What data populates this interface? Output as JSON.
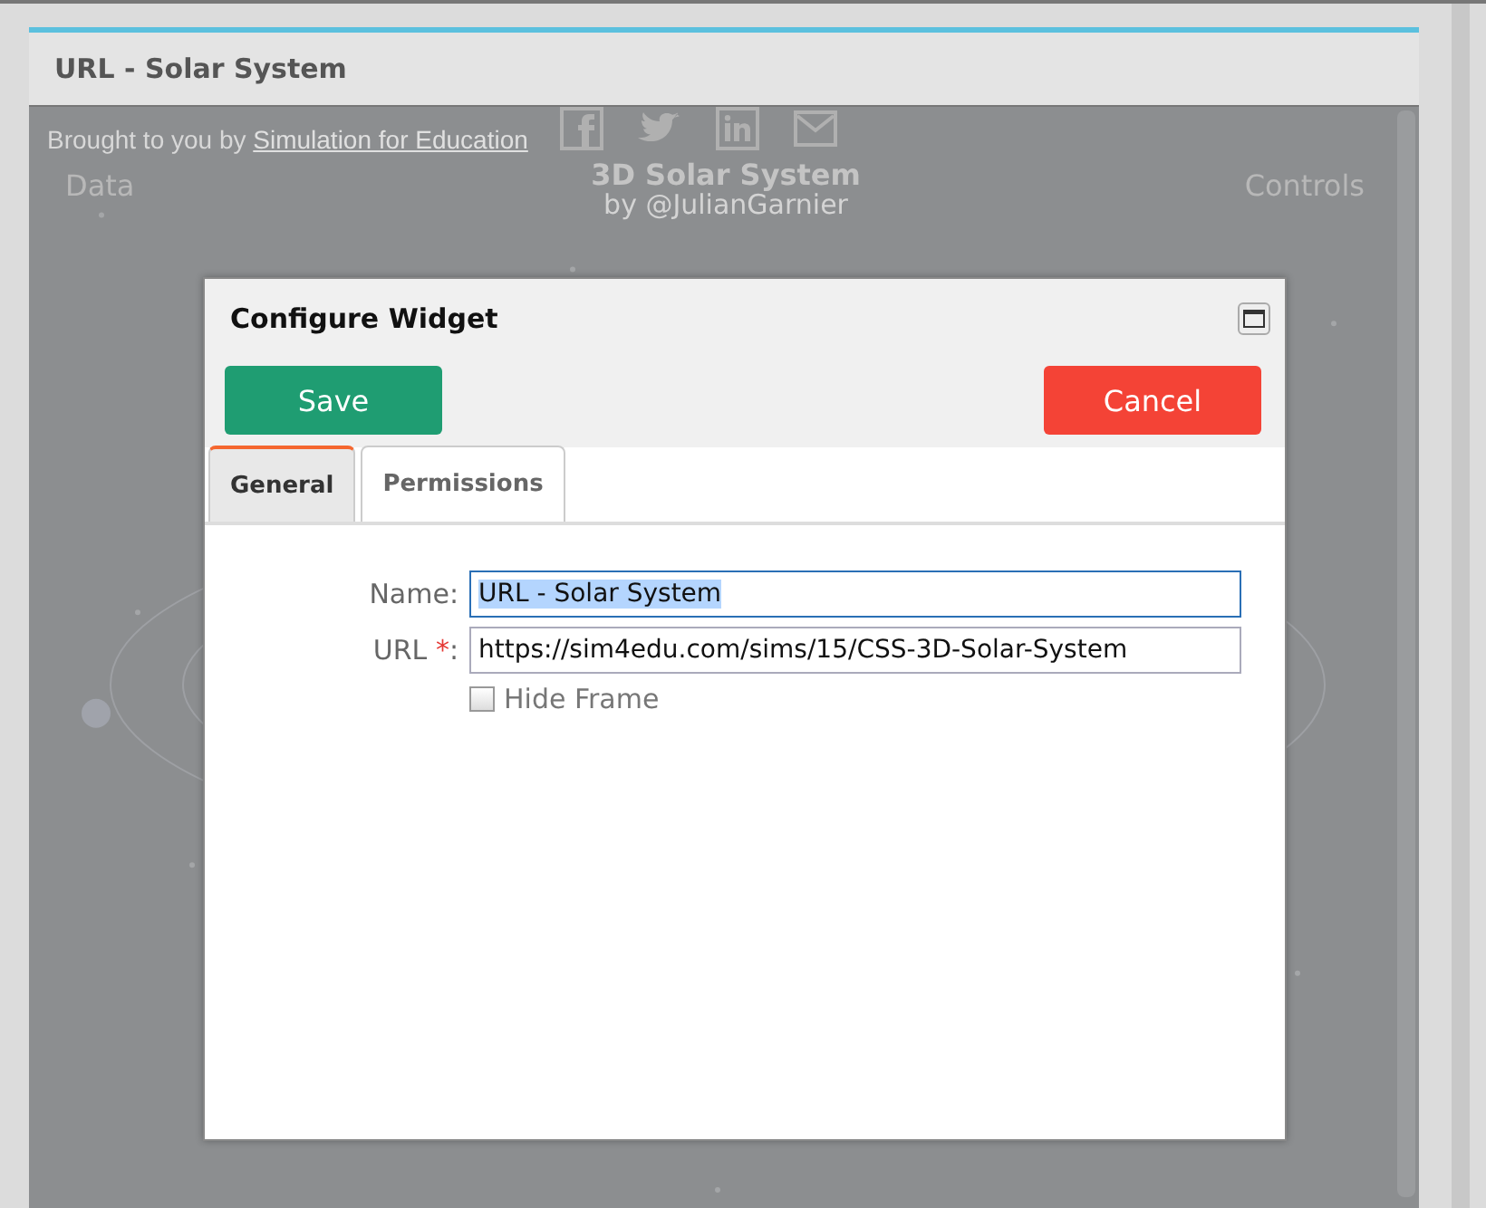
{
  "panel": {
    "title": "URL - Solar System"
  },
  "embed": {
    "credit": "Brought to you by",
    "credit_link": "Simulation for Education",
    "left_link": "Data",
    "title": "3D Solar System",
    "subtitle": "by @JulianGarnier",
    "right_link": "Controls",
    "share": [
      {
        "kind": "facebook"
      },
      {
        "kind": "twitter"
      },
      {
        "kind": "linkedin"
      },
      {
        "kind": "mail"
      }
    ]
  },
  "dialog": {
    "title": "Configure Widget",
    "buttons": [
      {
        "label": "Save",
        "kind": "primary"
      },
      {
        "label": "Cancel",
        "kind": "danger"
      }
    ],
    "tabs": [
      {
        "label": "General",
        "selected": true
      },
      {
        "label": "Permissions",
        "selected": false
      }
    ],
    "fields": [
      {
        "label": "Name:",
        "value": "URL - Solar System",
        "focused": true
      },
      {
        "label": "URL",
        "required_mark": "*",
        "suffix": ":",
        "value": "https://sim4edu.com/sims/15/CSS-3D-Solar-System",
        "focused": false
      }
    ],
    "checkbox": {
      "label": "Hide Frame",
      "checked": false
    }
  }
}
